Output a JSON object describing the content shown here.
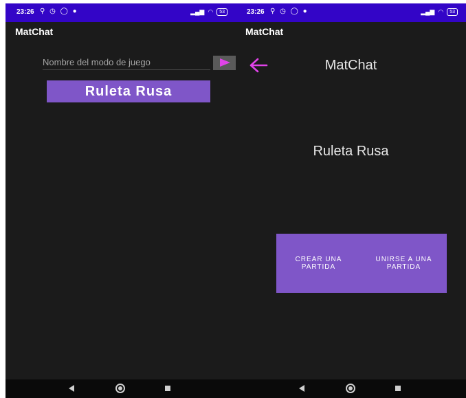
{
  "screens": [
    {
      "status_time": "23:26",
      "app_title": "MatChat",
      "mode_input": {
        "value": "",
        "placeholder": "Nombre del modo de juego"
      },
      "send_icon": "send-arrow-icon",
      "game_mode_button": "Ruleta Rusa"
    },
    {
      "status_time": "23:26",
      "app_title": "MatChat",
      "back_icon": "arrow-left-icon",
      "title": "MatChat",
      "mode_name": "Ruleta Rusa",
      "create_button": "CREAR UNA PARTIDA",
      "join_button": "UNIRSE A UNA PARTIDA"
    }
  ],
  "status_bar": {
    "battery": "53"
  },
  "colors": {
    "status_bar": "#3305c7",
    "background": "#1b1b1b",
    "accent": "#7f56c8",
    "icon_accent": "#e043e8"
  }
}
